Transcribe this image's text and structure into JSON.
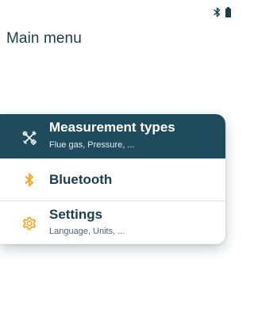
{
  "status_bar": {
    "icons": [
      "bluetooth-icon",
      "battery-icon"
    ]
  },
  "page": {
    "title": "Main menu"
  },
  "menu": {
    "items": [
      {
        "title": "Measurement types",
        "subtitle": "Flue gas, Pressure, ...",
        "icon": "measurement-icon",
        "selected": true
      },
      {
        "title": "Bluetooth",
        "subtitle": "",
        "icon": "bluetooth-icon",
        "selected": false
      },
      {
        "title": "Settings",
        "subtitle": "Language, Units, ...",
        "icon": "gear-icon",
        "selected": false
      }
    ]
  },
  "colors": {
    "selected_background": "#1f4b5c",
    "text_primary": "#1e3d4c",
    "accent_orange": "#f5a623"
  }
}
